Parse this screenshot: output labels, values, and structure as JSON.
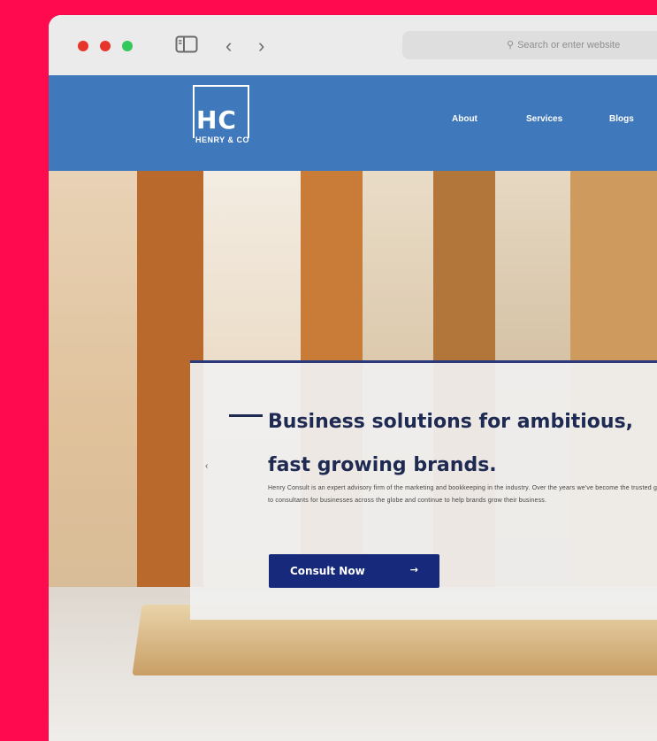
{
  "browser": {
    "address_placeholder": "Search or enter website"
  },
  "site": {
    "logo": {
      "letters": "HC",
      "subtitle": "HENRY & CO"
    },
    "nav": [
      "About",
      "Services",
      "Blogs"
    ]
  },
  "hero": {
    "headline": "Business solutions for ambitious,\nfast growing brands.",
    "body": "Henry Consult is an expert advisory firm of the marketing and bookkeeping in the industry. Over the years we've become the trusted go-to consultants for businesses across the globe and continue to help brands grow their business.",
    "cta_label": "Consult Now",
    "cta_arrow": "→"
  },
  "colors": {
    "background": "#ff0a4e",
    "header": "#3f78bb",
    "headline": "#1e2a52",
    "cta": "#17297a"
  }
}
